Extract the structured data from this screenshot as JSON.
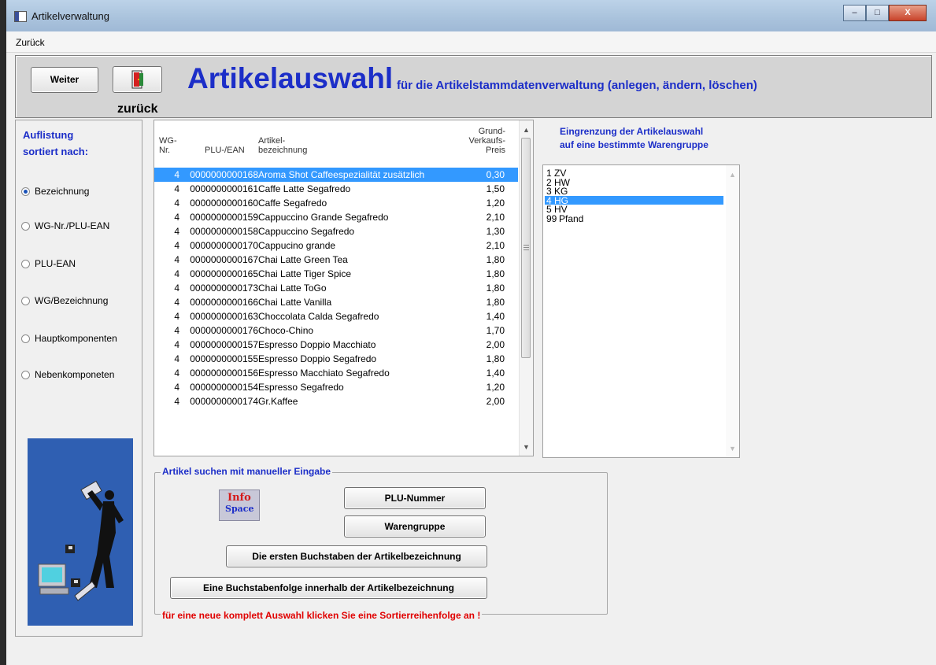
{
  "window": {
    "title": "Artikelverwaltung",
    "controls": [
      "–",
      "□",
      "X"
    ]
  },
  "menu": {
    "zurueck": "Zurück"
  },
  "header": {
    "weiter_label": "Weiter",
    "zurueck_label": "zurück",
    "title": "Artikelauswahl",
    "subtitle": "für die Artikelstammdatenverwaltung (anlegen, ändern, löschen)"
  },
  "sort": {
    "title_line1": "Auflistung",
    "title_line2": "sortiert nach:",
    "options": [
      "Bezeichnung",
      "WG-Nr./PLU-EAN",
      "PLU-EAN",
      "WG/Bezeichnung",
      "Hauptkomponenten",
      "Nebenkomponeten"
    ],
    "selected_index": 0
  },
  "articles": {
    "headers": {
      "wg_line1": "WG-",
      "wg_line2": "Nr.",
      "plu": "PLU-/EAN",
      "name_line1": "Artikel-",
      "name_line2": "bezeichnung",
      "price_line1": "Grund-",
      "price_line2": "Verkaufs-",
      "price_line3": "Preis"
    },
    "selected_index": 0,
    "rows": [
      {
        "wg": "4",
        "plu": "0000000000168",
        "name": "Aroma Shot Caffeespezialität zusätzlich",
        "price": "0,30"
      },
      {
        "wg": "4",
        "plu": "0000000000161",
        "name": "Caffe Latte Segafredo",
        "price": "1,50"
      },
      {
        "wg": "4",
        "plu": "0000000000160",
        "name": "Caffe Segafredo",
        "price": "1,20"
      },
      {
        "wg": "4",
        "plu": "0000000000159",
        "name": "Cappuccino Grande Segafredo",
        "price": "2,10"
      },
      {
        "wg": "4",
        "plu": "0000000000158",
        "name": "Cappuccino Segafredo",
        "price": "1,30"
      },
      {
        "wg": "4",
        "plu": "0000000000170",
        "name": "Cappucino grande",
        "price": "2,10"
      },
      {
        "wg": "4",
        "plu": "0000000000167",
        "name": "Chai Latte Green Tea",
        "price": "1,80"
      },
      {
        "wg": "4",
        "plu": "0000000000165",
        "name": "Chai Latte Tiger Spice",
        "price": "1,80"
      },
      {
        "wg": "4",
        "plu": "0000000000173",
        "name": "Chai Latte ToGo",
        "price": "1,80"
      },
      {
        "wg": "4",
        "plu": "0000000000166",
        "name": "Chai Latte Vanilla",
        "price": "1,80"
      },
      {
        "wg": "4",
        "plu": "0000000000163",
        "name": "Choccolata Calda Segafredo",
        "price": "1,40"
      },
      {
        "wg": "4",
        "plu": "0000000000176",
        "name": "Choco-Chino",
        "price": "1,70"
      },
      {
        "wg": "4",
        "plu": "0000000000157",
        "name": "Espresso Doppio Macchiato",
        "price": "2,00"
      },
      {
        "wg": "4",
        "plu": "0000000000155",
        "name": "Espresso Doppio Segafredo",
        "price": "1,80"
      },
      {
        "wg": "4",
        "plu": "0000000000156",
        "name": "Espresso Macchiato Segafredo",
        "price": "1,40"
      },
      {
        "wg": "4",
        "plu": "0000000000154",
        "name": "Espresso Segafredo",
        "price": "1,20"
      },
      {
        "wg": "4",
        "plu": "0000000000174",
        "name": "Gr.Kaffee",
        "price": "2,00"
      }
    ]
  },
  "warengruppe": {
    "title_line1": "Eingrenzung der Artikelauswahl",
    "title_line2": "auf eine bestimmte Warengruppe",
    "selected_index": 3,
    "items": [
      {
        "nr": "1",
        "code": "ZV"
      },
      {
        "nr": "2",
        "code": "HW"
      },
      {
        "nr": "3",
        "code": "KG"
      },
      {
        "nr": "4",
        "code": "HG"
      },
      {
        "nr": "5",
        "code": "HV"
      },
      {
        "nr": "99",
        "code": "Pfand"
      }
    ]
  },
  "search": {
    "legend": "Artikel suchen mit manueller Eingabe",
    "plu_button": "PLU-Nummer",
    "wg_button": "Warengruppe",
    "first_letters_button": "Die ersten Buchstaben der Artikelbezeichnung",
    "sequence_button": "Eine Buchstabenfolge innerhalb der Artikelbezeichnung",
    "hint": "für eine neue komplett Auswahl klicken Sie eine Sortierreihenfolge an !",
    "logo_line1": "Info",
    "logo_line2": "Space"
  }
}
